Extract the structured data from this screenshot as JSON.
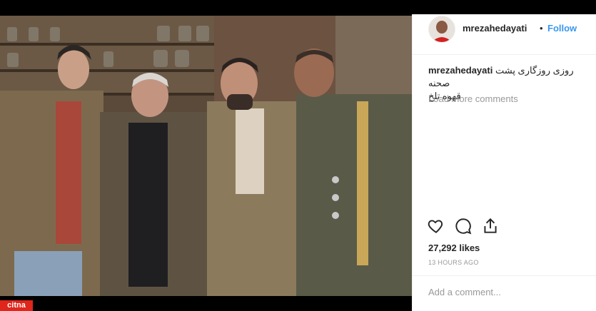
{
  "header": {
    "username": "mrezahedayati",
    "separator": "•",
    "follow_label": "Follow"
  },
  "caption": {
    "username": "mrezahedayati",
    "line1": "روزی روزگاری پشت صحنه",
    "line2": "قهوه تلخ"
  },
  "comments": {
    "load_more_label": "Load more comments"
  },
  "actions": {
    "like_icon": "heart-icon",
    "comment_icon": "comment-icon",
    "share_icon": "share-icon"
  },
  "stats": {
    "likes": "27,292 likes",
    "time": "13 HOURS AGO"
  },
  "add_comment": {
    "placeholder": "Add a comment..."
  },
  "watermark": {
    "logo_text": "citna"
  },
  "colors": {
    "link": "#3897f0",
    "text": "#262626",
    "muted": "#999999",
    "logo": "#e0251b"
  }
}
